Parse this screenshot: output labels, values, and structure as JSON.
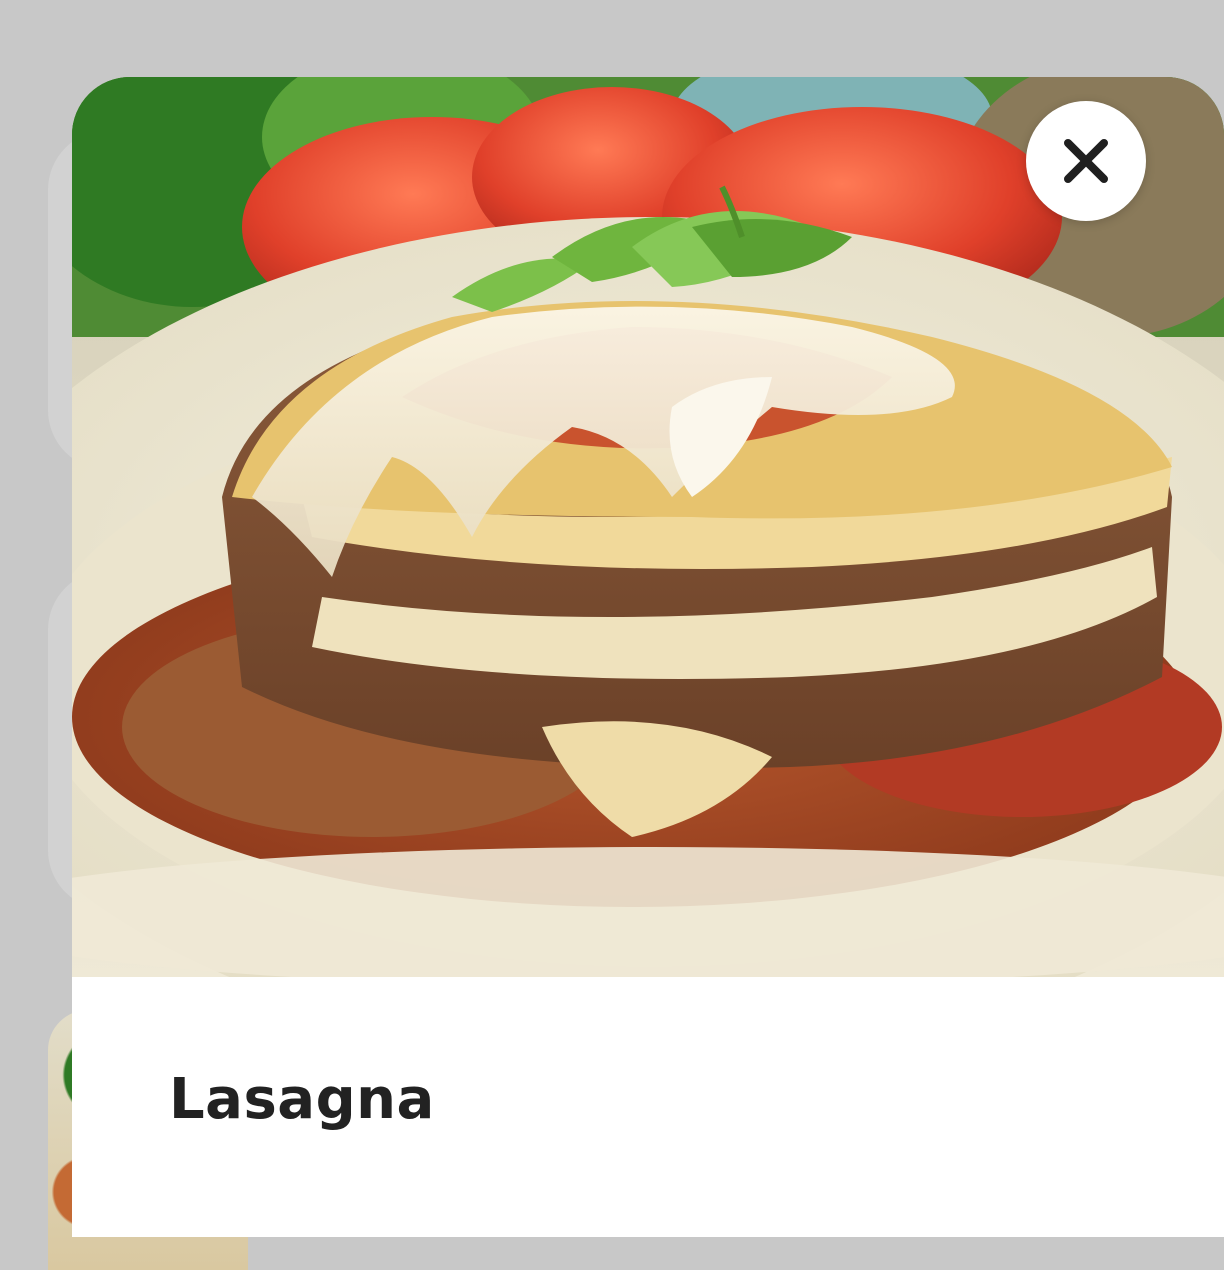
{
  "modal": {
    "title": "Lasagna",
    "close_icon": "close-icon",
    "image_alt": "lasagna-photo"
  },
  "colors": {
    "backdrop": "#c8c8c8",
    "modal_bg": "#ffffff",
    "title_text": "#222222",
    "close_bg": "#ffffff",
    "close_icon": "#1f1f1f"
  }
}
